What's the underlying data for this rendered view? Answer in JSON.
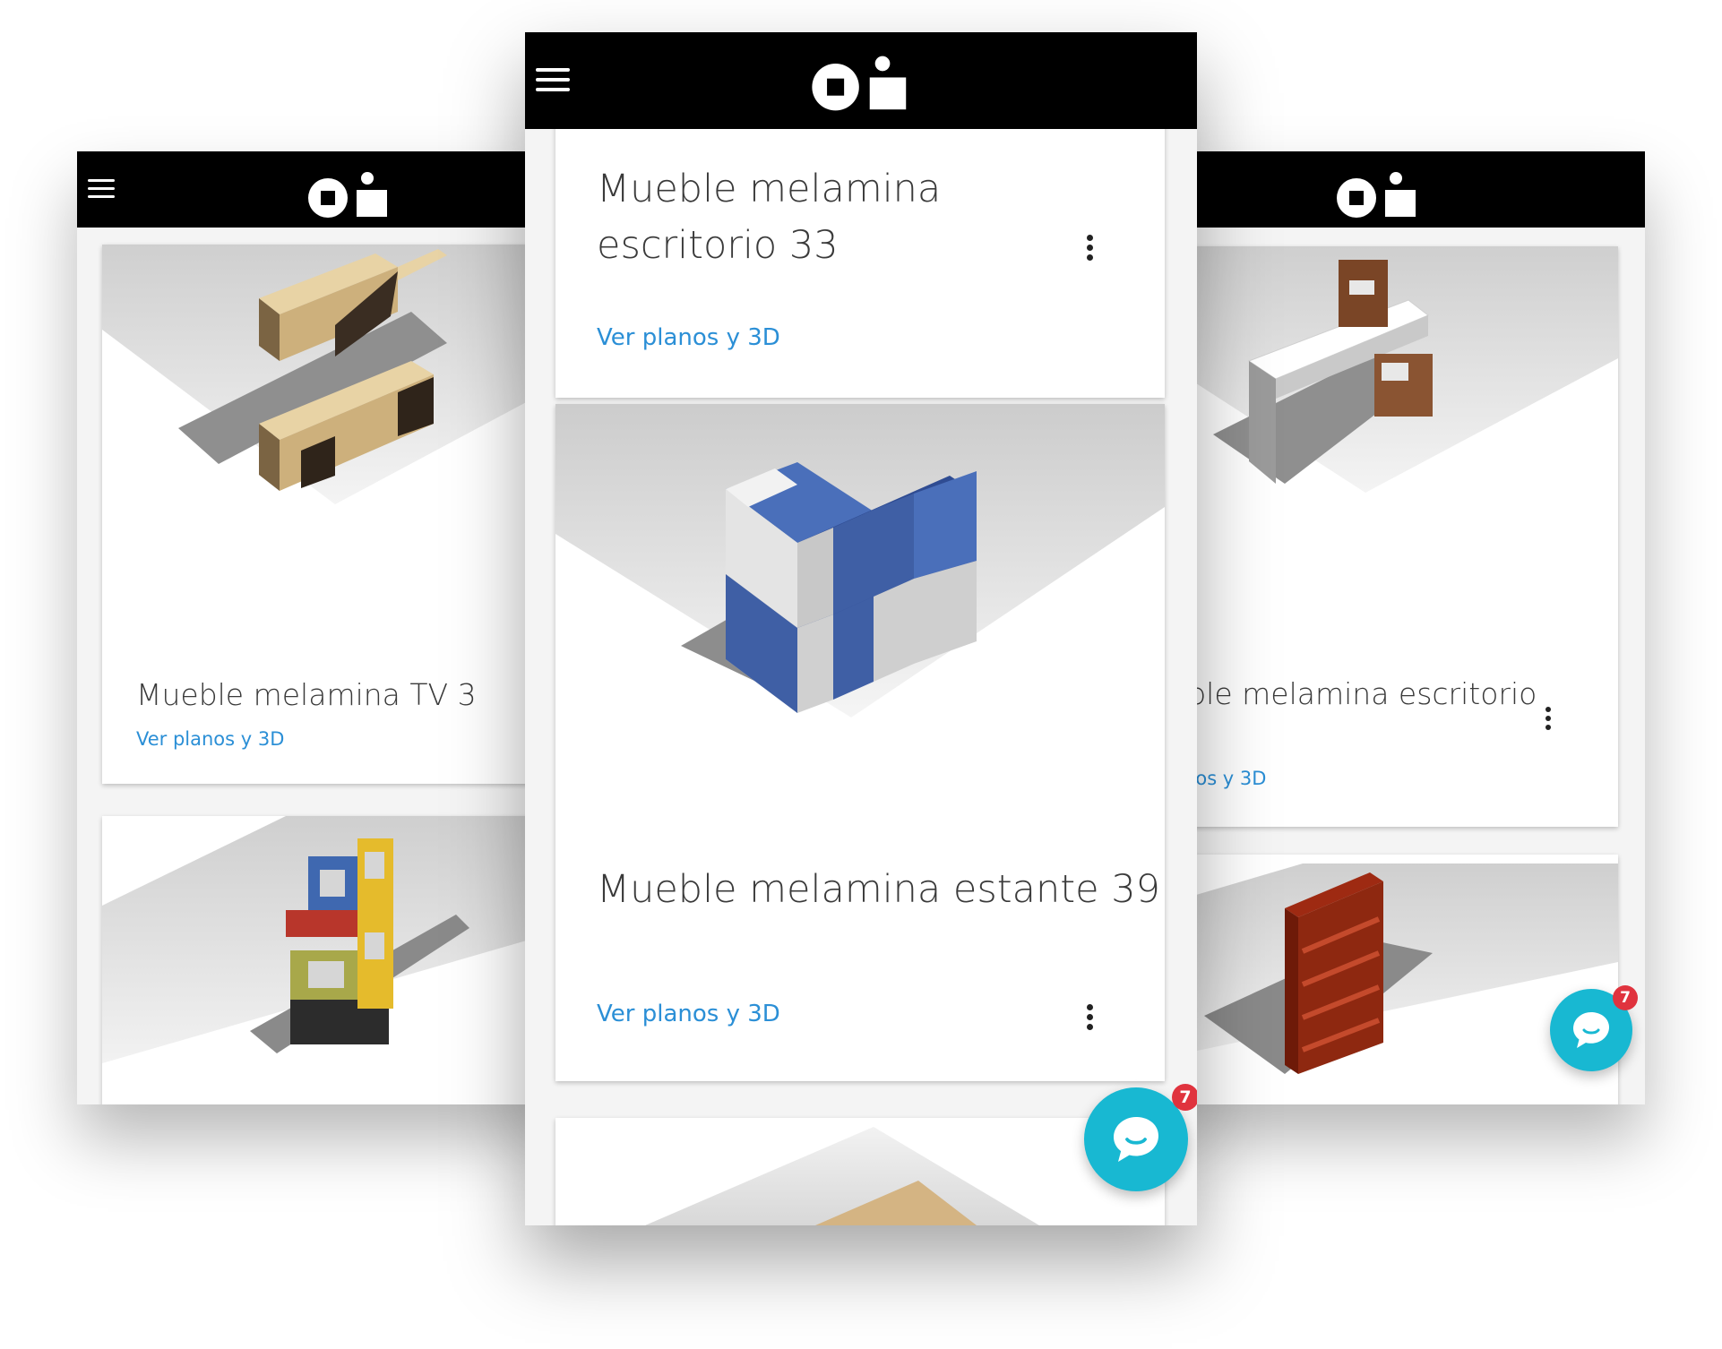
{
  "left": {
    "card1": {
      "title": "Mueble melamina TV 3",
      "link": "Ver planos y 3D"
    }
  },
  "center": {
    "card1": {
      "title": "Mueble melamina escritorio 33",
      "link": "Ver planos y 3D"
    },
    "card2": {
      "title": "Mueble melamina estante 39",
      "link": "Ver planos y 3D"
    },
    "chat_badge": "7"
  },
  "right": {
    "card1": {
      "title": "ueble melamina escritorio",
      "link": "planos y 3D"
    },
    "chat_badge": "7"
  },
  "colors": {
    "appbar": "#000000",
    "link": "#2b8fd6",
    "chat": "#18b8d2",
    "badge": "#e0333e"
  },
  "icons": [
    "menu-icon",
    "logo",
    "more-vert-icon",
    "chat-icon"
  ]
}
